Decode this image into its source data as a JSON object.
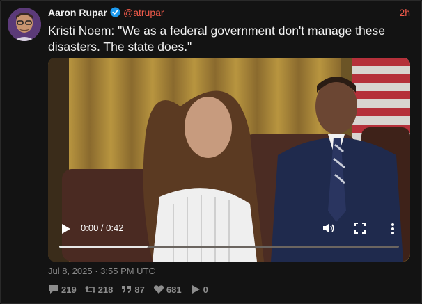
{
  "author": {
    "name": "Aaron Rupar",
    "handle": "@atrupar",
    "timestamp": "2h",
    "verified_icon": "verified-badge-icon"
  },
  "tweet": {
    "text": "Kristi Noem: \"We as a federal government don't manage these disasters. The state does.\""
  },
  "video": {
    "timecode": "0:00 / 0:42",
    "progress": 0.26,
    "icons": [
      "play-icon",
      "volume-icon",
      "fullscreen-icon",
      "more-options-icon"
    ]
  },
  "posted_at": "Jul 8, 2025 · 3:55 PM UTC",
  "stats": {
    "replies": "219",
    "retweets": "218",
    "quotes": "87",
    "likes": "681",
    "views": "0"
  },
  "colors": {
    "background": "#131313",
    "accent": "#f05a4a",
    "verified": "#1d9bf0",
    "muted": "#8d8d8d"
  }
}
